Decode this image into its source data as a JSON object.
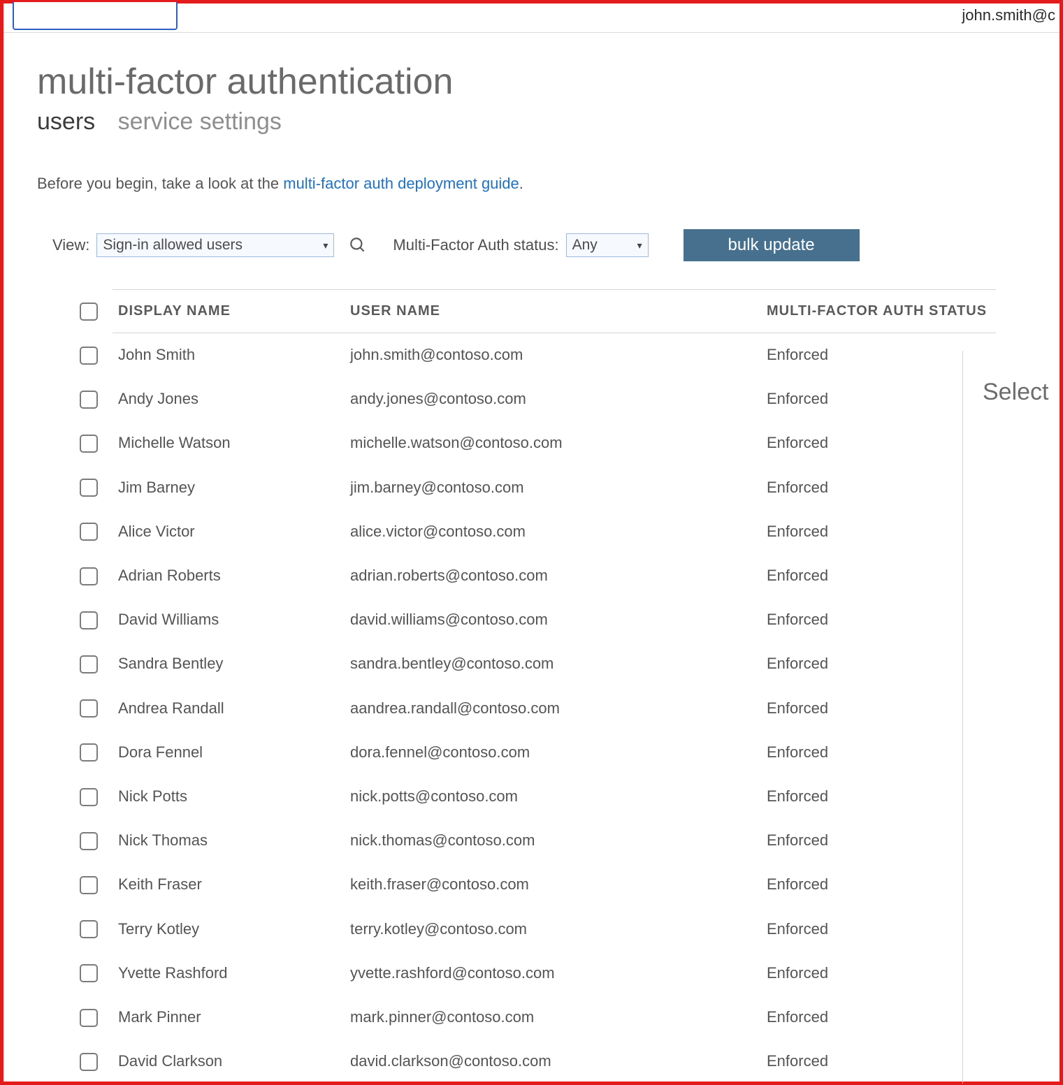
{
  "header": {
    "user_email_partial": "john.smith@c"
  },
  "page_title": "multi-factor authentication",
  "tabs": {
    "users": "users",
    "service_settings": "service settings"
  },
  "intro": {
    "prefix": "Before you begin, take a look at the ",
    "link": "multi-factor auth deployment guide",
    "suffix": "."
  },
  "controls": {
    "view_label": "View:",
    "view_selected": "Sign-in allowed users",
    "mfa_status_label": "Multi-Factor Auth status:",
    "mfa_status_selected": "Any",
    "bulk_update": "bulk update"
  },
  "table": {
    "columns": {
      "display_name": "DISPLAY NAME",
      "user_name": "USER NAME",
      "mfa_status": "MULTI-FACTOR AUTH STATUS"
    },
    "rows": [
      {
        "display_name": "John Smith",
        "user_name": "john.smith@contoso.com",
        "status": "Enforced"
      },
      {
        "display_name": "Andy Jones",
        "user_name": "andy.jones@contoso.com",
        "status": "Enforced"
      },
      {
        "display_name": "Michelle Watson",
        "user_name": "michelle.watson@contoso.com",
        "status": "Enforced"
      },
      {
        "display_name": "Jim Barney",
        "user_name": "jim.barney@contoso.com",
        "status": "Enforced"
      },
      {
        "display_name": "Alice Victor",
        "user_name": "alice.victor@contoso.com",
        "status": "Enforced"
      },
      {
        "display_name": "Adrian Roberts",
        "user_name": "adrian.roberts@contoso.com",
        "status": "Enforced"
      },
      {
        "display_name": "David Williams",
        "user_name": "david.williams@contoso.com",
        "status": "Enforced"
      },
      {
        "display_name": "Sandra Bentley",
        "user_name": "sandra.bentley@contoso.com",
        "status": "Enforced"
      },
      {
        "display_name": "Andrea Randall",
        "user_name": "aandrea.randall@contoso.com",
        "status": "Enforced"
      },
      {
        "display_name": "Dora Fennel",
        "user_name": "dora.fennel@contoso.com",
        "status": "Enforced"
      },
      {
        "display_name": "Nick Potts",
        "user_name": "nick.potts@contoso.com",
        "status": "Enforced"
      },
      {
        "display_name": "Nick Thomas",
        "user_name": "nick.thomas@contoso.com",
        "status": "Enforced"
      },
      {
        "display_name": "Keith Fraser",
        "user_name": "keith.fraser@contoso.com",
        "status": "Enforced"
      },
      {
        "display_name": "Terry Kotley",
        "user_name": "terry.kotley@contoso.com",
        "status": "Enforced"
      },
      {
        "display_name": "Yvette Rashford",
        "user_name": "yvette.rashford@contoso.com",
        "status": "Enforced"
      },
      {
        "display_name": "Mark Pinner",
        "user_name": "mark.pinner@contoso.com",
        "status": "Enforced"
      },
      {
        "display_name": "David Clarkson",
        "user_name": "david.clarkson@contoso.com",
        "status": "Enforced"
      }
    ]
  },
  "side_panel": {
    "select_label": "Select"
  }
}
